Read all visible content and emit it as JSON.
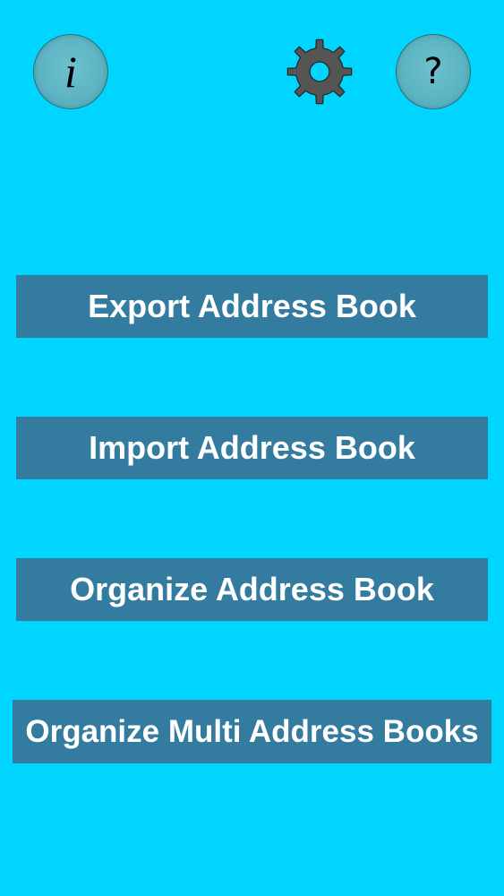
{
  "header": {
    "info_glyph": "i",
    "info_icon": "info-icon",
    "settings_icon": "gear-icon",
    "help_glyph": "?",
    "help_icon": "question-mark-icon"
  },
  "actions": {
    "export_label": "Export Address Book",
    "import_label": "Import Address Book",
    "organize_label": "Organize Address Book",
    "organize_multi_label": "Organize Multi Address Books"
  },
  "colors": {
    "background": "#00d5ff",
    "button": "#337b9f",
    "button_text": "#ffffff",
    "round_button": "#5db4c2",
    "gear": "#555555"
  }
}
